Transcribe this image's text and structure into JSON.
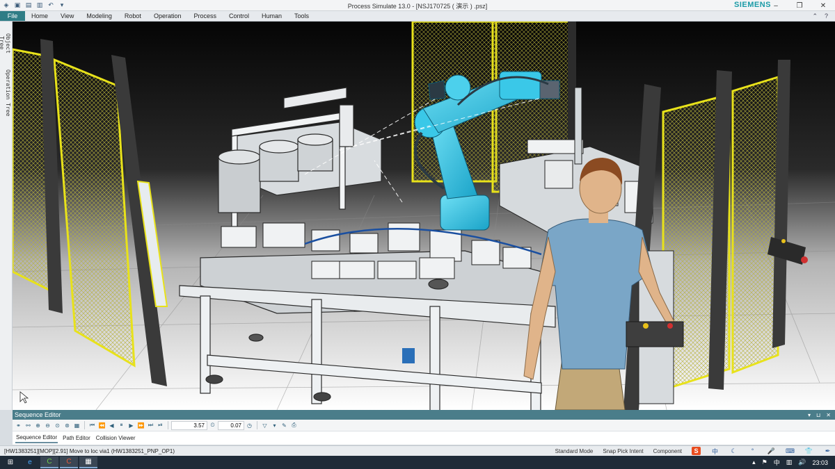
{
  "window": {
    "title": "Process Simulate 13.0 - [NSJ170725 ( 演示 ) .psz]",
    "brand": "SIEMENS",
    "brand_color": "#1a9aa6",
    "controls": [
      "minimize-icon",
      "restore-icon",
      "close-icon"
    ]
  },
  "quick_access": [
    "app-icon",
    "save-icon",
    "open-icon",
    "folder-icon",
    "undo-icon",
    "dropdown-icon"
  ],
  "ribbon": {
    "file_label": "File",
    "file_color": "#2f7d86",
    "tabs": [
      {
        "id": "home",
        "label": "Home"
      },
      {
        "id": "view",
        "label": "View"
      },
      {
        "id": "modeling",
        "label": "Modeling"
      },
      {
        "id": "robot",
        "label": "Robot"
      },
      {
        "id": "operation",
        "label": "Operation"
      },
      {
        "id": "process",
        "label": "Process"
      },
      {
        "id": "control",
        "label": "Control"
      },
      {
        "id": "human",
        "label": "Human"
      },
      {
        "id": "tools",
        "label": "Tools"
      }
    ]
  },
  "left_panel": {
    "tabs": [
      {
        "id": "object-tree",
        "label": "Object Tree"
      },
      {
        "id": "operation-tree",
        "label": "Operation Tree"
      }
    ]
  },
  "sequence_editor": {
    "title": "Sequence Editor",
    "time_value": "3.57",
    "step_value": "0.07",
    "tabs": [
      {
        "id": "sequence-editor",
        "label": "Sequence Editor",
        "active": true
      },
      {
        "id": "path-editor",
        "label": "Path Editor",
        "active": false
      },
      {
        "id": "collision-viewer",
        "label": "Collision Viewer",
        "active": false
      }
    ]
  },
  "status_bar": {
    "message": "[HW1383251][MOP][2.91] Move to loc via1 (HW1383251_PNP_OP1)",
    "mode": "Standard Mode",
    "snap": "Snap Pick Intent",
    "component": "Component"
  },
  "tray": {
    "ime": "中",
    "clock": "23:03"
  },
  "scene_colors": {
    "robot": "#35c4e6",
    "fence": "#e8e21a",
    "shirt": "#7aa6c7",
    "pants": "#c2a878",
    "skin": "#e0b48a",
    "hair": "#8b4b22"
  }
}
